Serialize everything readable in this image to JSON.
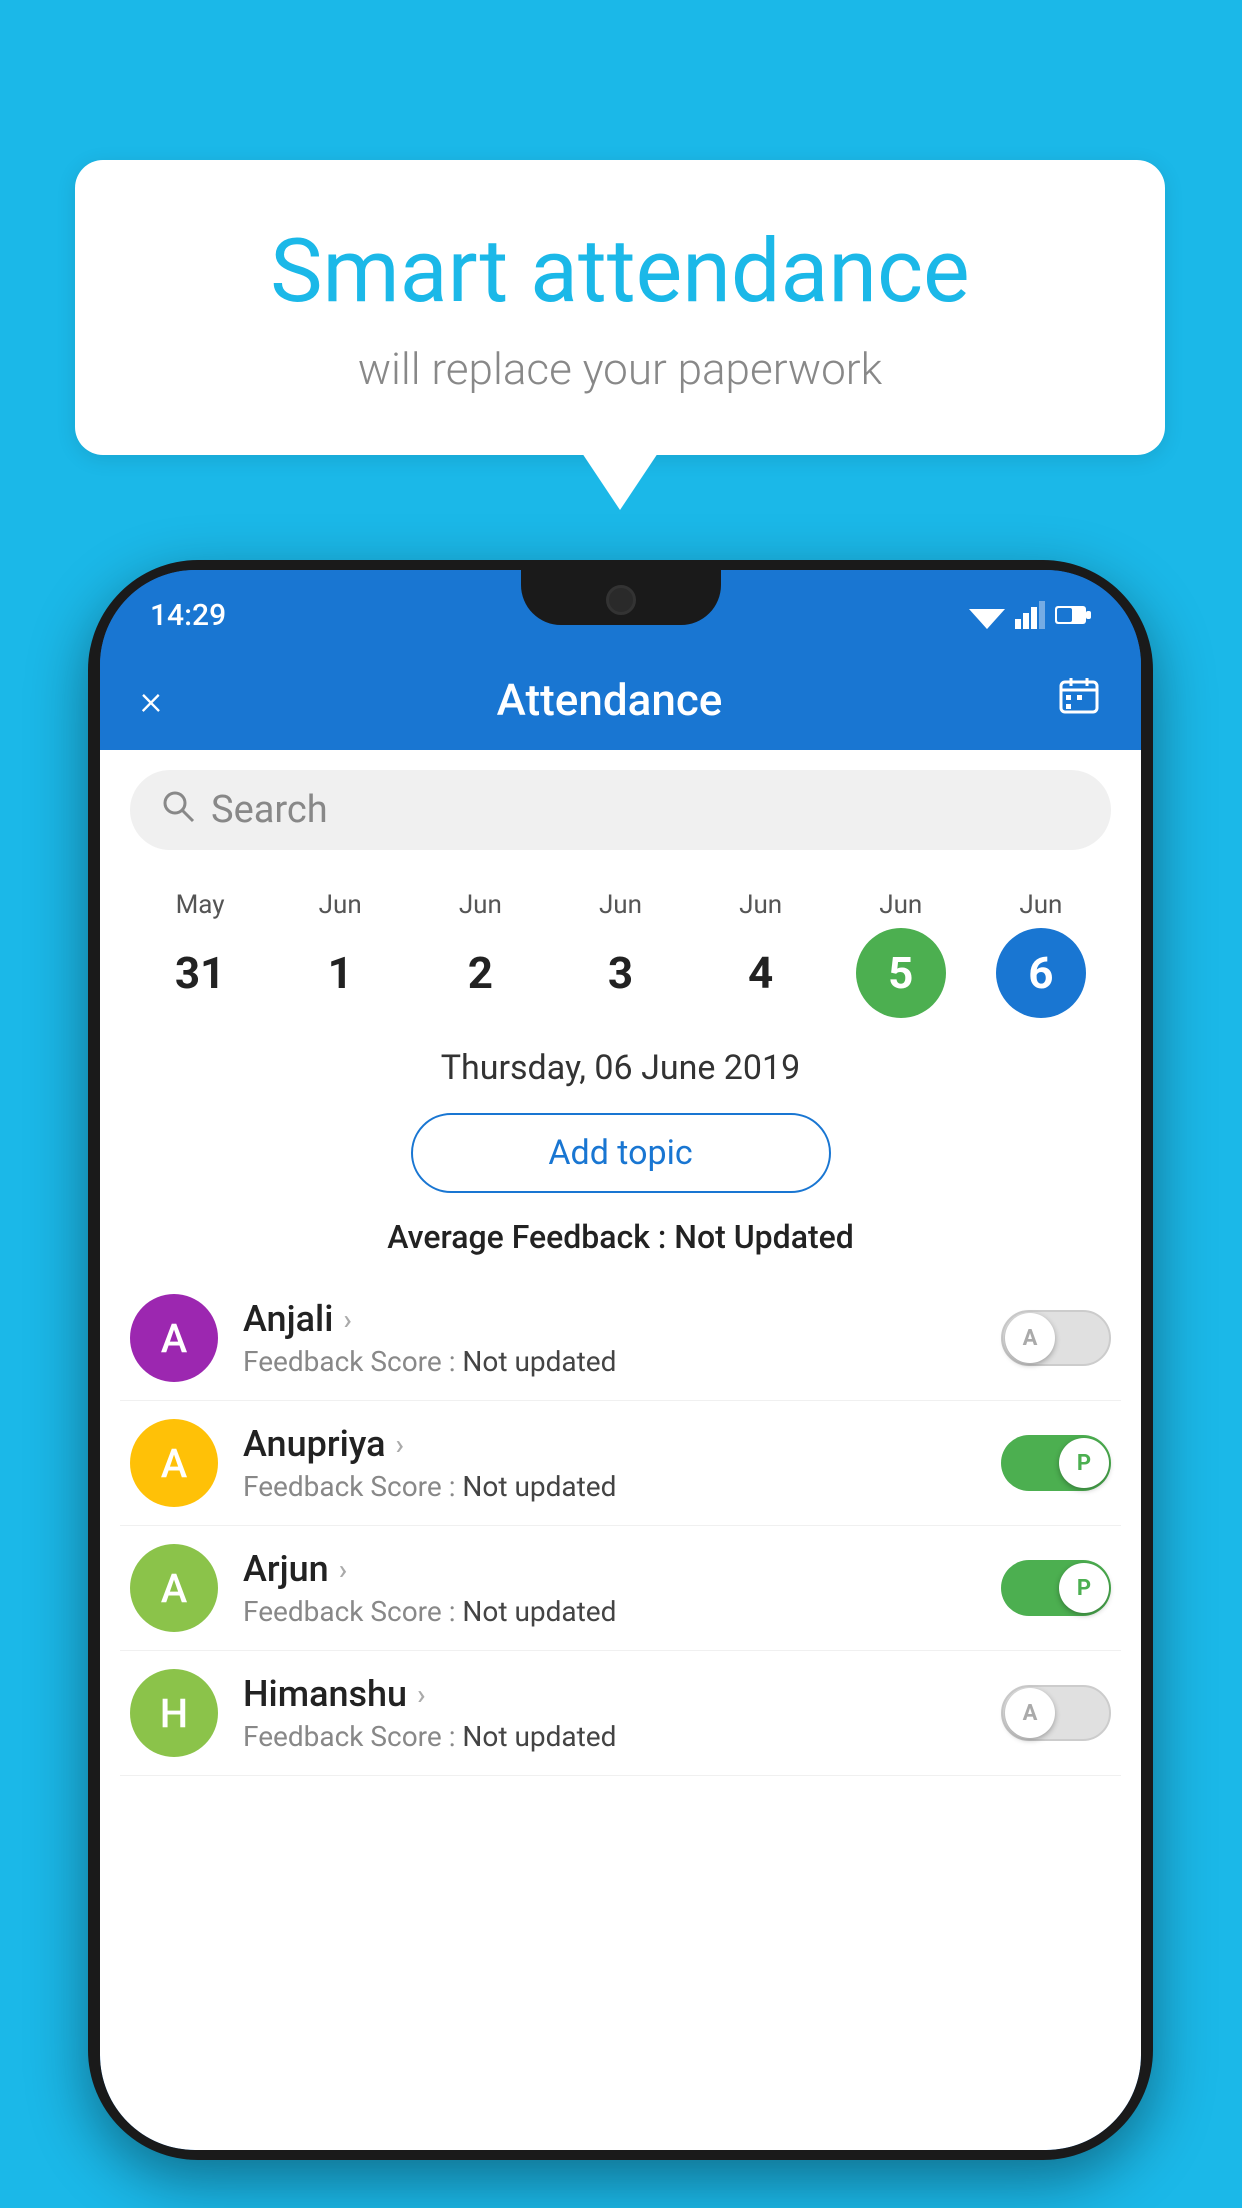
{
  "background_color": "#1bb8e8",
  "speech_bubble": {
    "title": "Smart attendance",
    "subtitle": "will replace your paperwork"
  },
  "status_bar": {
    "time": "14:29"
  },
  "app_header": {
    "title": "Attendance",
    "close_icon": "×",
    "calendar_icon": "📅"
  },
  "search": {
    "placeholder": "Search"
  },
  "calendar": {
    "days": [
      {
        "month": "May",
        "date": "31",
        "style": "normal"
      },
      {
        "month": "Jun",
        "date": "1",
        "style": "normal"
      },
      {
        "month": "Jun",
        "date": "2",
        "style": "normal"
      },
      {
        "month": "Jun",
        "date": "3",
        "style": "normal"
      },
      {
        "month": "Jun",
        "date": "4",
        "style": "normal"
      },
      {
        "month": "Jun",
        "date": "5",
        "style": "today"
      },
      {
        "month": "Jun",
        "date": "6",
        "style": "selected"
      }
    ]
  },
  "selected_date": "Thursday, 06 June 2019",
  "add_topic_label": "Add topic",
  "average_feedback_label": "Average Feedback :",
  "average_feedback_value": "Not Updated",
  "students": [
    {
      "name": "Anjali",
      "avatar_letter": "A",
      "avatar_color": "#9c27b0",
      "feedback_label": "Feedback Score :",
      "feedback_value": "Not updated",
      "toggle": "off",
      "toggle_letter": "A"
    },
    {
      "name": "Anupriya",
      "avatar_letter": "A",
      "avatar_color": "#ffc107",
      "feedback_label": "Feedback Score :",
      "feedback_value": "Not updated",
      "toggle": "on",
      "toggle_letter": "P"
    },
    {
      "name": "Arjun",
      "avatar_letter": "A",
      "avatar_color": "#8bc34a",
      "feedback_label": "Feedback Score :",
      "feedback_value": "Not updated",
      "toggle": "on",
      "toggle_letter": "P"
    },
    {
      "name": "Himanshu",
      "avatar_letter": "H",
      "avatar_color": "#8bc34a",
      "feedback_label": "Feedback Score :",
      "feedback_value": "Not updated",
      "toggle": "off",
      "toggle_letter": "A"
    }
  ]
}
